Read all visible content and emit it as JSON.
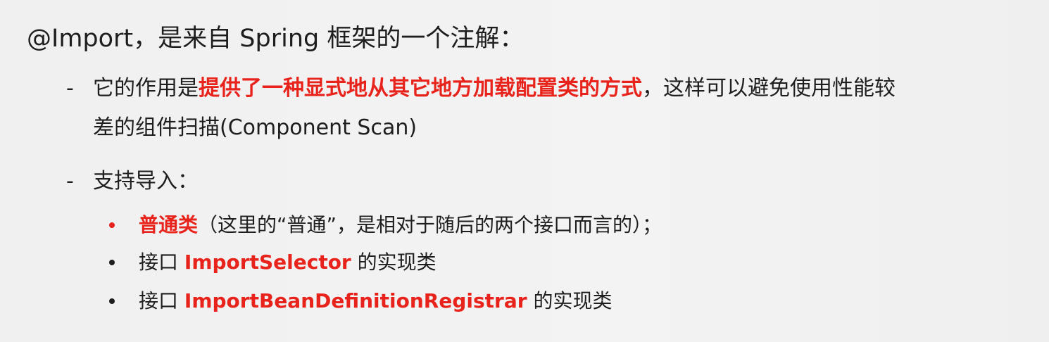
{
  "title": "@Import，是来自 Spring 框架的一个注解：",
  "dash_items": [
    {
      "dash": "-",
      "line1_prefix": "它的作用是",
      "line1_highlight": "提供了一种显式地从其它地方加载配置类的方式",
      "line1_suffix": "，这样可以避免使用性能较",
      "line2": "差的组件扫描(Component Scan)"
    },
    {
      "dash": "-",
      "text": "支持导入："
    }
  ],
  "bullets": [
    {
      "highlight": "普通类",
      "text": "（这里的“普通”，是相对于随后的两个接口而言的）；"
    },
    {
      "prefix": "接口 ",
      "highlight": "ImportSelector",
      "suffix": " 的实现类"
    },
    {
      "prefix": "接口 ",
      "highlight": "ImportBeanDefinitionRegistrar",
      "suffix": " 的实现类"
    }
  ],
  "colors": {
    "highlight": "#e8231c",
    "text": "#1e1e1e",
    "background": "#f1f1f1"
  }
}
